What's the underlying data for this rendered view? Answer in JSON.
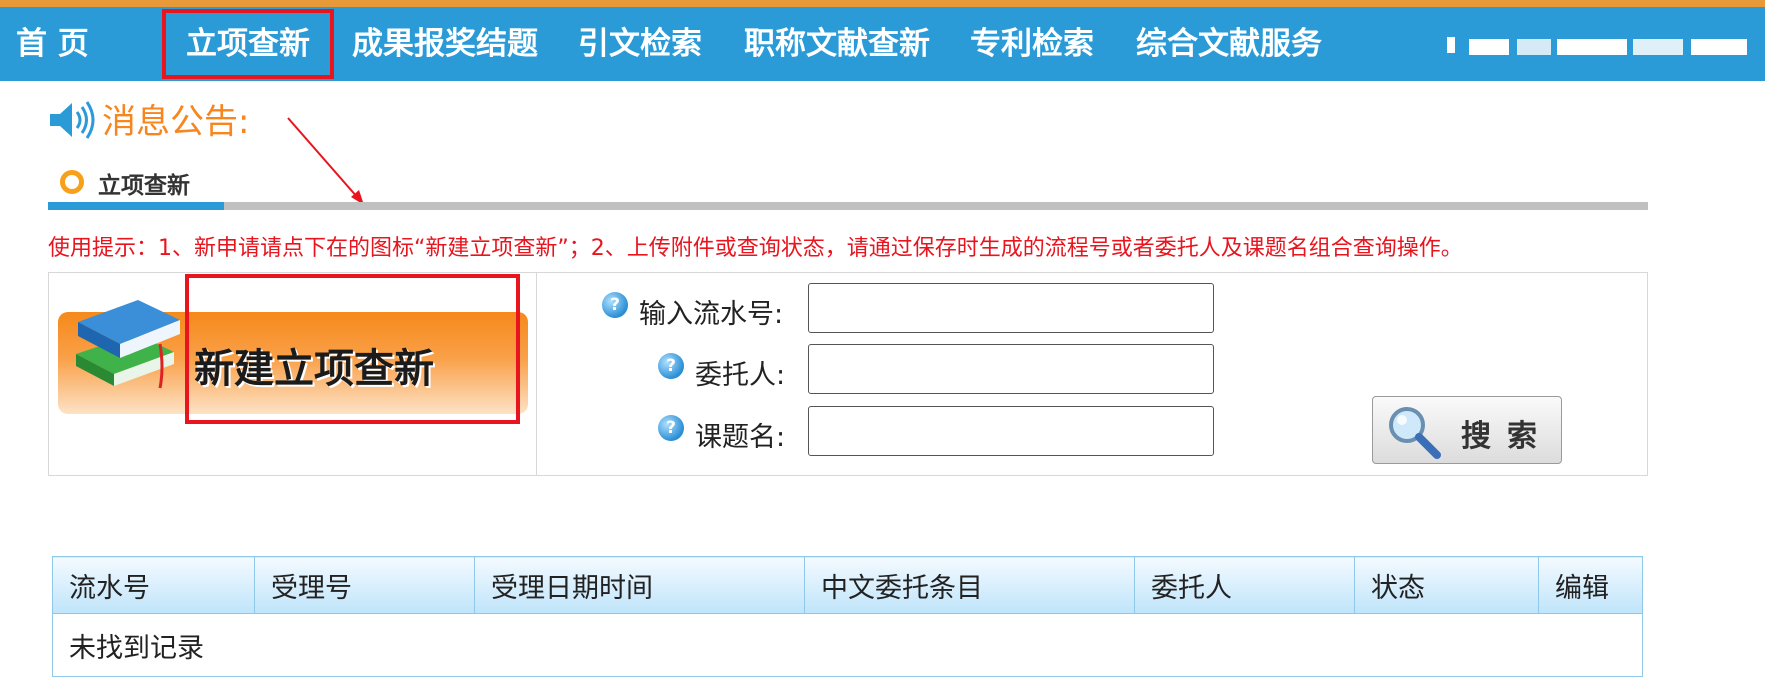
{
  "nav": {
    "home": "首 页",
    "items": [
      "立项查新",
      "成果报奖结题",
      "引文检索",
      "职称文献查新",
      "专利检索",
      "综合文献服务"
    ],
    "active_index": 0
  },
  "notice": {
    "title": "消息公告:"
  },
  "tab": {
    "label": "立项查新"
  },
  "usage_tip": "使用提示：1、新申请请点下在的图标“新建立项查新”；2、上传附件或查询状态，请通过保存时生成的流程号或者委托人及课题名组合查询操作。",
  "banner": {
    "label": "新建立项查新"
  },
  "form": {
    "serial_label": "输入流水号:",
    "client_label": "委托人:",
    "topic_label": "课题名:",
    "serial_value": "",
    "client_value": "",
    "topic_value": "",
    "search_button": "搜索"
  },
  "table": {
    "headers": [
      "流水号",
      "受理号",
      "受理日期时间",
      "中文委托条目",
      "委托人",
      "状态",
      "编辑"
    ],
    "empty_text": "未找到记录"
  },
  "colors": {
    "nav_bg": "#2b9bd8",
    "accent_orange": "#f7861f",
    "alert_red": "#e8141e"
  }
}
